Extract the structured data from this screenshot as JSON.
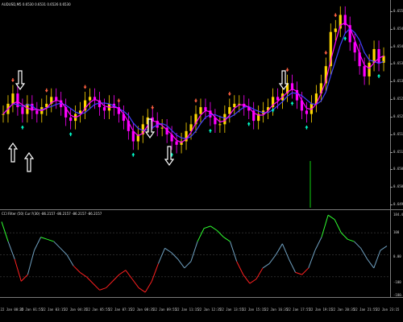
{
  "window": {
    "title": "AUDUSD,M5 0.6530 0.6531 0.6526 0.6530",
    "indicator_title": "CCI Filter (50) Cur:?(30) -86.2157 -86.2157 -86.2157 -86.2157"
  },
  "price_axis": [
    "0.6550",
    "0.6545",
    "0.6540",
    "0.6535",
    "0.6530",
    "0.6525",
    "0.6520",
    "0.6515",
    "0.6510",
    "0.6505",
    "0.6500",
    "0.6495"
  ],
  "indicator_axis": [
    "184.45",
    "100",
    "0.00",
    "-100",
    "-180.77"
  ],
  "time_axis": [
    "22 Jan 00:35",
    "22 Jan 01:55",
    "22 Jan 03:15",
    "22 Jan 04:35",
    "22 Jan 05:55",
    "22 Jan 07:15",
    "22 Jan 08:35",
    "22 Jan 09:55",
    "22 Jan 11:15",
    "22 Jan 12:35",
    "22 Jan 13:55",
    "22 Jan 15:15",
    "22 Jan 16:35",
    "22 Jan 17:55",
    "22 Jan 19:15",
    "22 Jan 20:35",
    "22 Jan 21:55",
    "22 Jan 23:15"
  ],
  "colors": {
    "background": "#000000",
    "bull_candle": "#ffd700",
    "bear_candle": "#ff00ff",
    "ma_fast": "#ff00ff",
    "ma_slow": "#4040ff",
    "up_arrow": "#00ffcc",
    "down_arrow": "#ff6040",
    "cci_positive": "#30ff30",
    "cci_neutral": "#6fa0c0",
    "cci_negative": "#ff2020"
  },
  "chart_data": [
    {
      "type": "line",
      "title": "AUDUSD,M5",
      "series": [
        {
          "values": [
            0.6521,
            0.6524,
            0.6527,
            0.6523,
            0.6521,
            0.6524,
            0.6522,
            0.6521,
            0.6523,
            0.6524,
            0.6526,
            0.6525,
            0.6523,
            0.652,
            0.6519,
            0.6521,
            0.6522,
            0.6525,
            0.6526,
            0.6525,
            0.6523,
            0.6522,
            0.6524,
            0.6523,
            0.6521,
            0.6519,
            0.6516,
            0.6513,
            0.6515,
            0.6518,
            0.652,
            0.6519,
            0.6517,
            0.6517,
            0.6515,
            0.6513,
            0.6512,
            0.6513,
            0.6516,
            0.6518,
            0.6521,
            0.6523,
            0.6522,
            0.652,
            0.6518,
            0.6518,
            0.6521,
            0.6523,
            0.6524,
            0.6524,
            0.6523,
            0.6522,
            0.6519,
            0.6521,
            0.6522,
            0.6523,
            0.6526,
            0.6525,
            0.6527,
            0.653,
            0.6528,
            0.6525,
            0.6522,
            0.6521,
            0.6524,
            0.6527,
            0.653,
            0.6535,
            0.6545,
            0.6546,
            0.655,
            0.6547,
            0.6542,
            0.6539,
            0.6535,
            0.6532,
            0.6536,
            0.654,
            0.6536,
            0.6538
          ]
        }
      ],
      "ylim": [
        0.6495,
        0.6552
      ]
    },
    {
      "type": "line",
      "title": "CCI Filter (50)",
      "series": [
        {
          "values": [
            150,
            60,
            -20,
            -120,
            -90,
            20,
            80,
            70,
            60,
            30,
            0,
            -50,
            -80,
            -100,
            -130,
            -160,
            -150,
            -120,
            -90,
            -70,
            -110,
            -150,
            -170,
            -120,
            -40,
            30,
            10,
            -20,
            -60,
            -30,
            60,
            120,
            130,
            110,
            80,
            60,
            -30,
            -90,
            -130,
            -110,
            -60,
            -40,
            0,
            50,
            -20,
            -80,
            -90,
            -60,
            20,
            80,
            180,
            160,
            100,
            70,
            60,
            30,
            -20,
            -60,
            20,
            40
          ]
        }
      ],
      "ylim": [
        -180.77,
        184.45
      ]
    }
  ]
}
